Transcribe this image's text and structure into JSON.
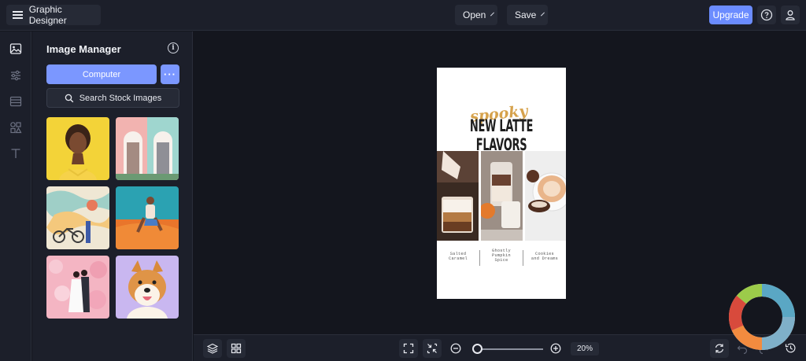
{
  "app": {
    "title": "Graphic Designer",
    "menus": {
      "open": "Open",
      "save": "Save"
    },
    "upgrade": "Upgrade"
  },
  "rail": {
    "items": [
      "image-icon",
      "sliders-icon",
      "background-icon",
      "shapes-icon",
      "text-icon"
    ]
  },
  "panel": {
    "title": "Image Manager",
    "computer_label": "Computer",
    "more_label": "···",
    "stock_label": "Search Stock Images",
    "thumbnails": [
      "portrait-yellow",
      "pink-building-doors",
      "mural-bicycle",
      "person-on-sand",
      "wedding-couple-flowers",
      "shiba-inu"
    ]
  },
  "design": {
    "script_text": "spooky",
    "headline": "NEW LATTE FLAVORS",
    "captions": [
      {
        "lines": [
          "Salted",
          "Caramel"
        ]
      },
      {
        "lines": [
          "Ghostly",
          "Pumpkin",
          "Spice"
        ]
      },
      {
        "lines": [
          "Cookies",
          "and Dreams"
        ]
      }
    ]
  },
  "bottom": {
    "zoom": "20%",
    "zoom_level": 0.05
  },
  "colors": {
    "accent": "#6b8cff",
    "bg": "#14161e",
    "panel": "#1c1f2a"
  }
}
